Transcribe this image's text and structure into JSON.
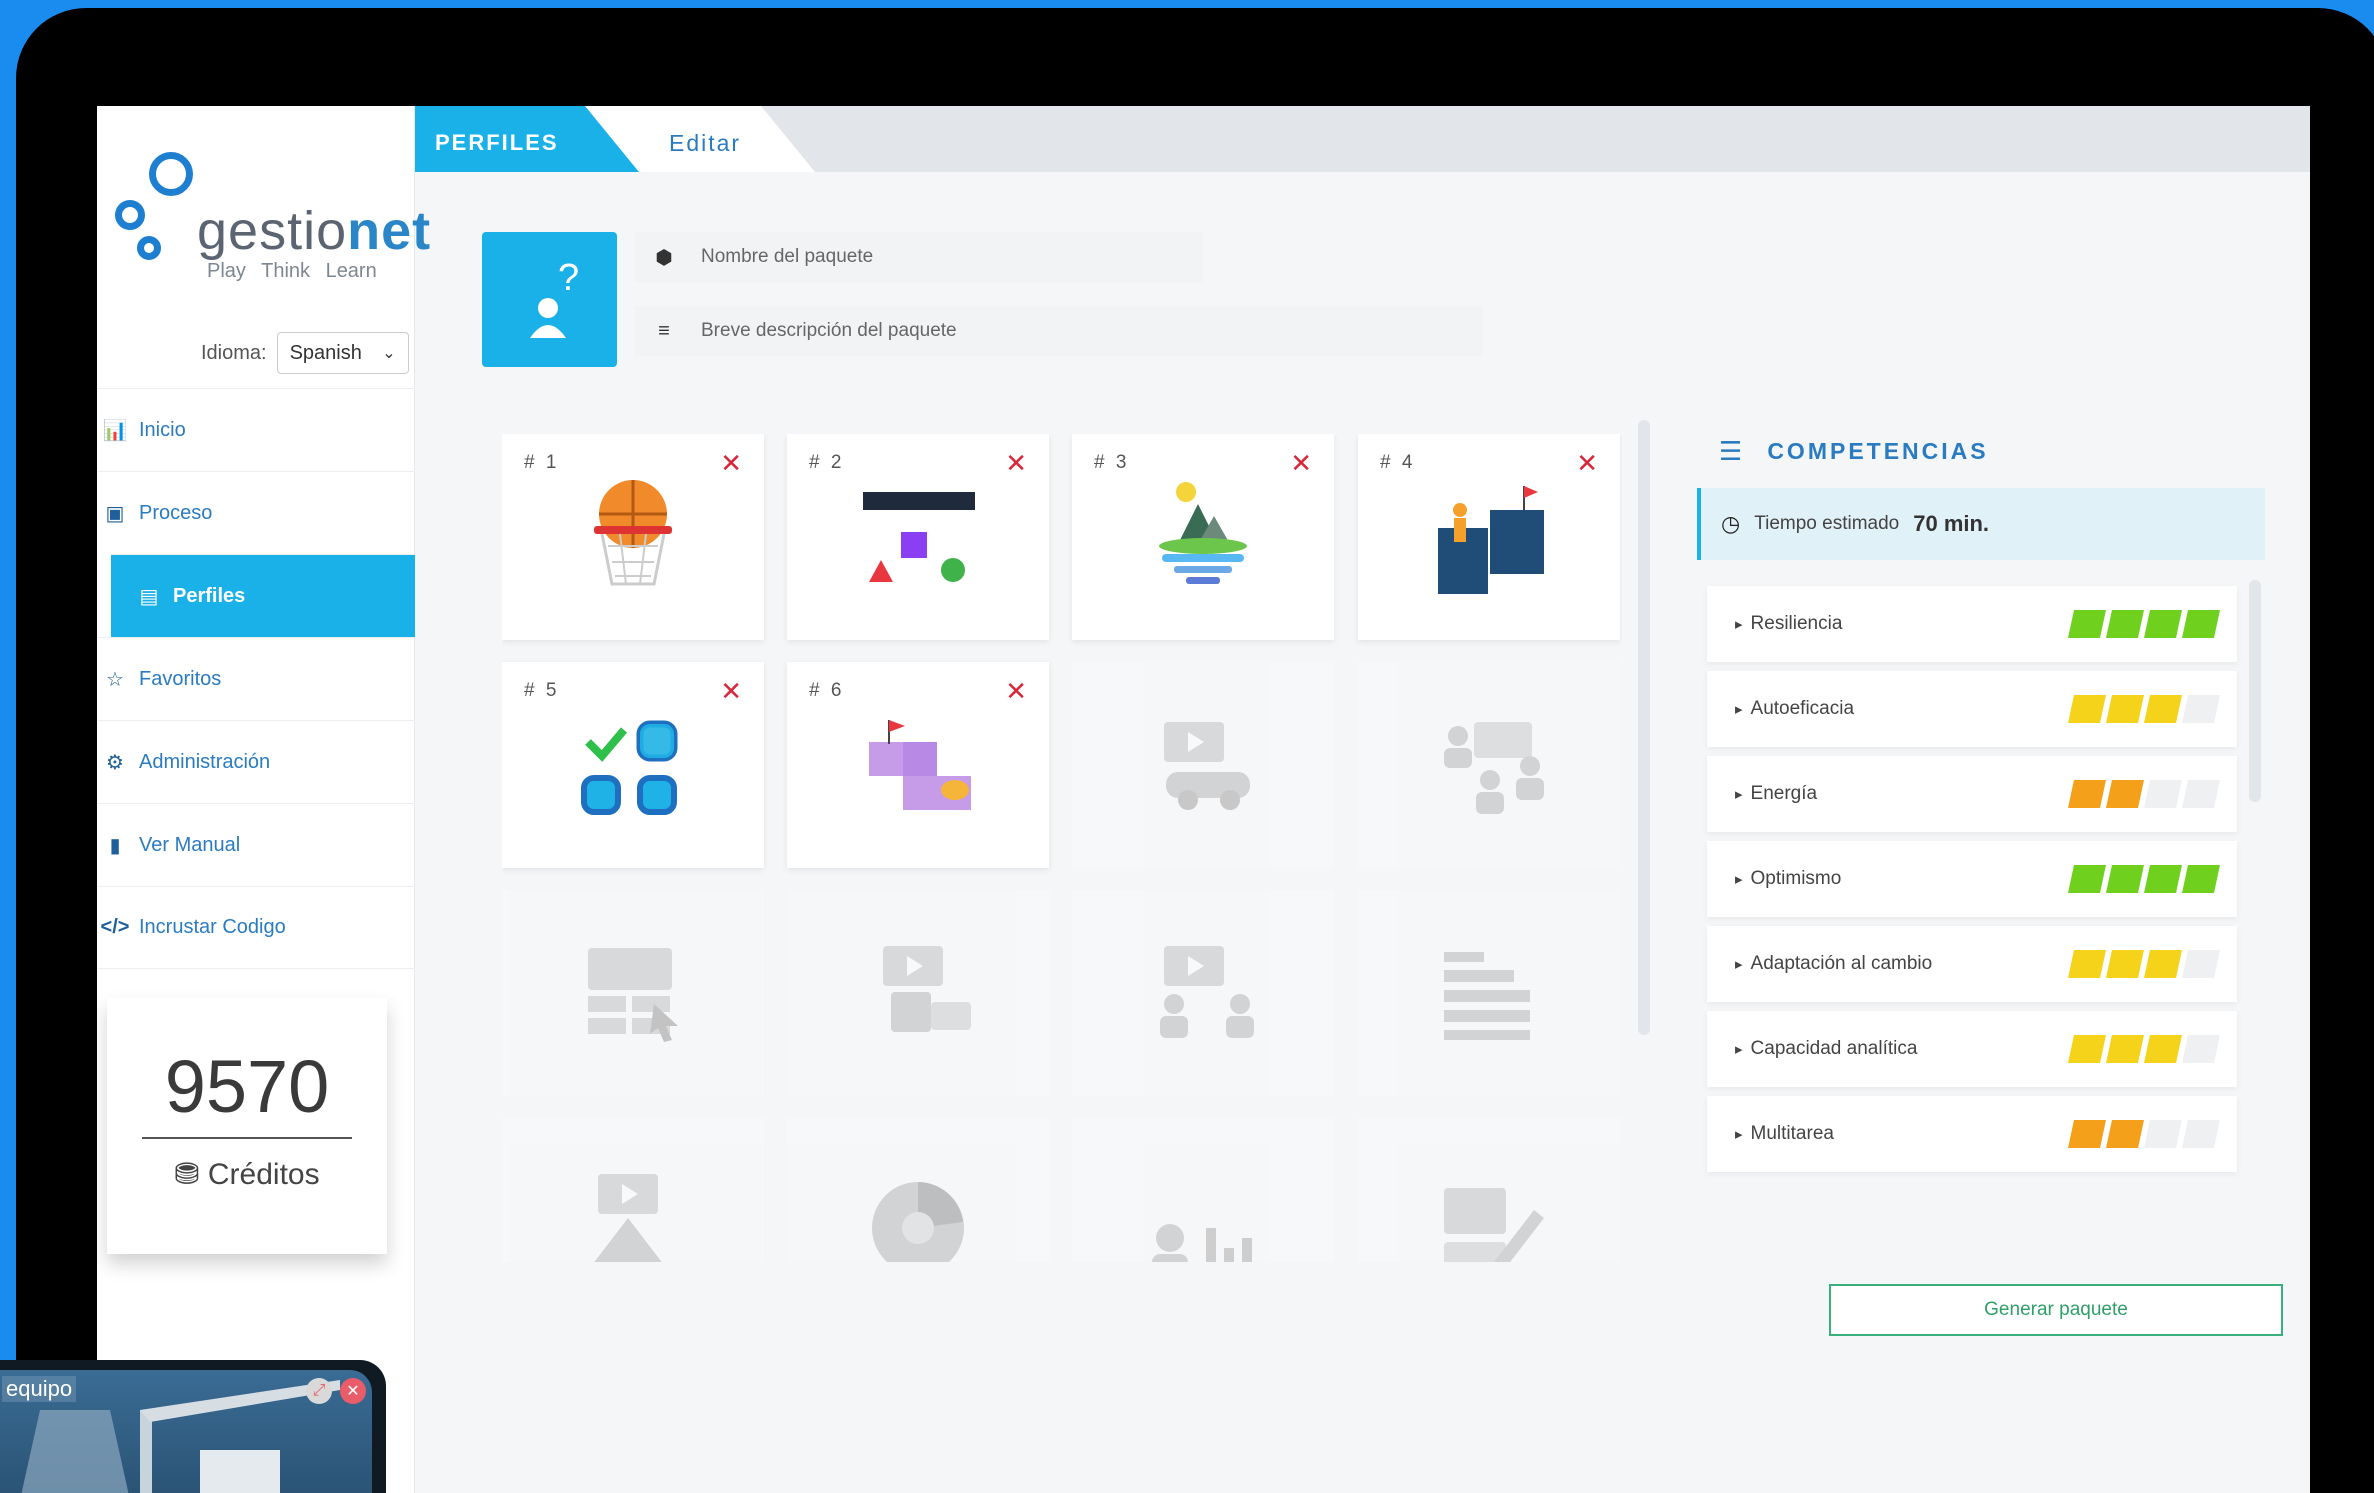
{
  "tabs": {
    "profiles": "PERFILES",
    "edit": "Editar"
  },
  "logo": {
    "name_part1": "gestio",
    "name_part2": "net",
    "tagline": "Play Think Learn"
  },
  "language": {
    "label": "Idioma:",
    "value": "Spanish"
  },
  "nav": [
    {
      "label": "Inicio",
      "icon": "chart-icon"
    },
    {
      "label": "Proceso",
      "icon": "process-icon"
    },
    {
      "label": "Perfiles",
      "icon": "profile-card-icon",
      "active": true
    },
    {
      "label": "Favoritos",
      "icon": "star-icon"
    },
    {
      "label": "Administración",
      "icon": "admin-icon"
    },
    {
      "label": "Ver Manual",
      "icon": "book-icon"
    },
    {
      "label": "Incrustar Codigo",
      "icon": "code-icon"
    }
  ],
  "credits": {
    "value": "9570",
    "label": "Créditos"
  },
  "package": {
    "name_placeholder": "Nombre del paquete",
    "desc_placeholder": "Breve descripción del paquete"
  },
  "cards": [
    {
      "num": "# 1",
      "icon": "basketball-hoop-icon"
    },
    {
      "num": "# 2",
      "icon": "shapes-mobile-icon"
    },
    {
      "num": "# 3",
      "icon": "iceberg-icon"
    },
    {
      "num": "# 4",
      "icon": "podium-icon"
    },
    {
      "num": "# 5",
      "icon": "checklist-grid-icon"
    },
    {
      "num": "# 6",
      "icon": "blocks-flag-icon"
    }
  ],
  "ghost_cards": [
    "video-car-icon",
    "people-chat-icon",
    "image-grid-cursor-icon",
    "video-factory-icon",
    "video-people-icon",
    "list-hand-icon",
    "video-pyramid-icon",
    "pie-chart-icon",
    "person-barchart-icon",
    "image-edit-icon"
  ],
  "competencias": {
    "title": "COMPETENCIAS",
    "tiempo_label": "Tiempo estimado",
    "tiempo_value": "70 min.",
    "items": [
      {
        "label": "Resiliencia",
        "level": 4,
        "color": "#6fd11e"
      },
      {
        "label": "Autoeficacia",
        "level": 3,
        "color": "#f5d31a"
      },
      {
        "label": "Energía",
        "level": 2,
        "color": "#f5a01a"
      },
      {
        "label": "Optimismo",
        "level": 4,
        "color": "#6fd11e"
      },
      {
        "label": "Adaptación al cambio",
        "level": 3,
        "color": "#f5d31a"
      },
      {
        "label": "Capacidad analítica",
        "level": 3,
        "color": "#f5d31a"
      },
      {
        "label": "Multitarea",
        "level": 2,
        "color": "#f5a01a"
      }
    ]
  },
  "generate_button": "Generar paquete",
  "popup": {
    "title": "equipo"
  }
}
